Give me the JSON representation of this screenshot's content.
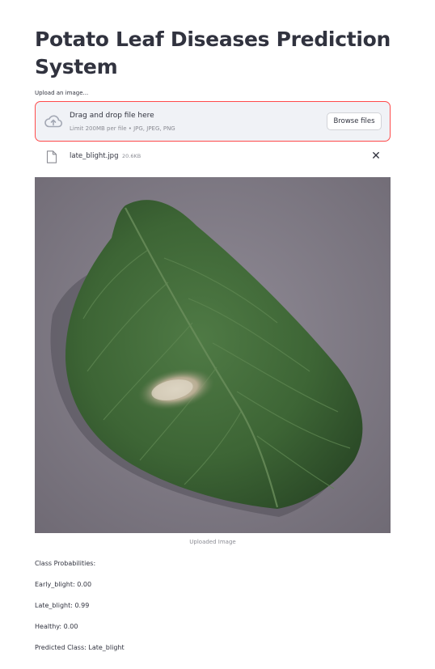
{
  "header": {
    "title": "Potato Leaf Diseases Prediction System"
  },
  "uploader": {
    "label": "Upload an image...",
    "drop_title": "Drag and drop file here",
    "drop_limit": "Limit 200MB per file • JPG, JPEG, PNG",
    "browse_label": "Browse files",
    "icon": "cloud-upload-icon"
  },
  "uploaded_file": {
    "name": "late_blight.jpg",
    "size": "20.6KB",
    "remove_symbol": "✕",
    "icon": "file-icon"
  },
  "image": {
    "caption": "Uploaded Image"
  },
  "results": {
    "heading": "Class Probabilities:",
    "early_blight": "Early_blight: 0.00",
    "late_blight": "Late_blight: 0.99",
    "healthy": "Healthy: 0.00",
    "predicted": "Predicted Class: Late_blight"
  },
  "colors": {
    "accent_border": "#ff4b4b",
    "dropzone_bg": "#f0f2f6",
    "text": "#31333f",
    "muted_text": "#8b8c94"
  }
}
